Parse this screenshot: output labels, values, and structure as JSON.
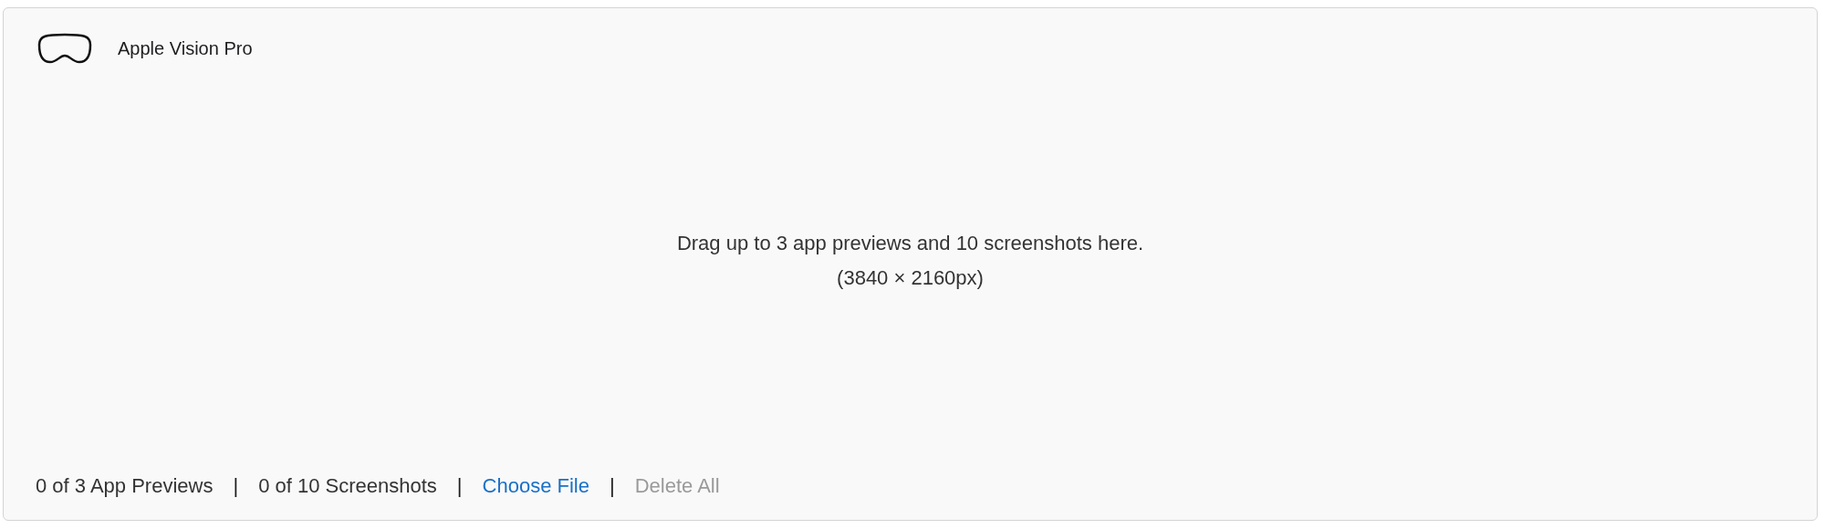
{
  "device": {
    "name": "Apple Vision Pro"
  },
  "dropzone": {
    "message": "Drag up to 3 app previews and 10 screenshots here.",
    "size": "(3840 × 2160px)"
  },
  "footer": [
    {
      "kind": "count",
      "text": "0 of 3 App Previews"
    },
    {
      "kind": "separator",
      "text": "|"
    },
    {
      "kind": "count",
      "text": "0 of 10 Screenshots"
    },
    {
      "kind": "separator",
      "text": "|"
    },
    {
      "kind": "link",
      "text": "Choose File",
      "disabled": false
    },
    {
      "kind": "separator",
      "text": "|"
    },
    {
      "kind": "link",
      "text": "Delete All",
      "disabled": true
    }
  ]
}
